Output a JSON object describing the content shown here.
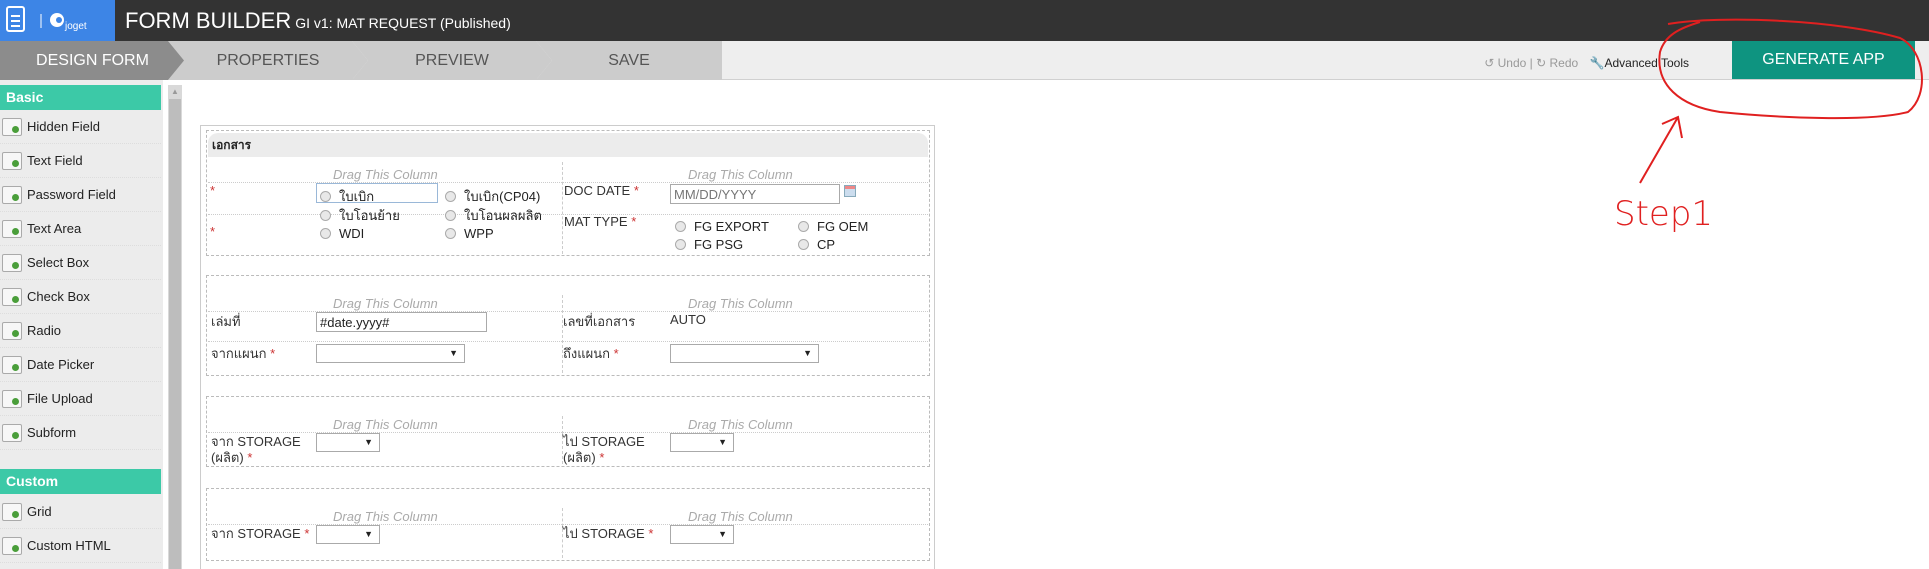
{
  "header": {
    "app_name": "joget",
    "title": "FORM BUILDER",
    "subtitle": "GI v1: MAT REQUEST (Published)"
  },
  "nav": {
    "steps": [
      "DESIGN FORM",
      "PROPERTIES",
      "PREVIEW",
      "SAVE"
    ],
    "undo": "Undo",
    "redo": "Redo",
    "advanced": "Advanced Tools",
    "generate": "GENERATE APP"
  },
  "sidebar": {
    "basic": "Basic",
    "basic_items": [
      "Hidden Field",
      "Text Field",
      "Password Field",
      "Text Area",
      "Select Box",
      "Check Box",
      "Radio",
      "Date Picker",
      "File Upload",
      "Subform"
    ],
    "custom": "Custom",
    "custom_items": [
      "Grid",
      "Custom HTML"
    ]
  },
  "form": {
    "drag": "Drag This Column",
    "section1": {
      "title": "เอกสาร",
      "req": "*",
      "options_row1": [
        "ใบเบิก",
        "ใบเบิก(CP04)",
        "ใบโอนย้าย",
        "ใบโอนผลผลิต"
      ],
      "options_row2": [
        "WDI",
        "WPP"
      ],
      "doc_date_label": "DOC DATE",
      "doc_date_placeholder": "MM/DD/YYYY",
      "mat_type_label": "MAT TYPE",
      "mat_types": [
        "FG EXPORT",
        "FG OEM",
        "FG PSG",
        "CP"
      ]
    },
    "section2": {
      "book_label": "เล่มที่",
      "book_value": "#date.yyyy#",
      "docno_label": "เลขที่เอกสาร",
      "docno_value": "AUTO",
      "from_dept": "จากแผนก",
      "to_dept": "ถึงแผนก"
    },
    "section3": {
      "from_storage": "จาก STORAGE",
      "to_storage": "ไป STORAGE",
      "produced": "(ผลิต)"
    },
    "section4": {
      "from_storage": "จาก STORAGE",
      "to_storage": "ไป STORAGE"
    }
  },
  "annotation": {
    "text": "Step1",
    "color": "#e02020"
  }
}
